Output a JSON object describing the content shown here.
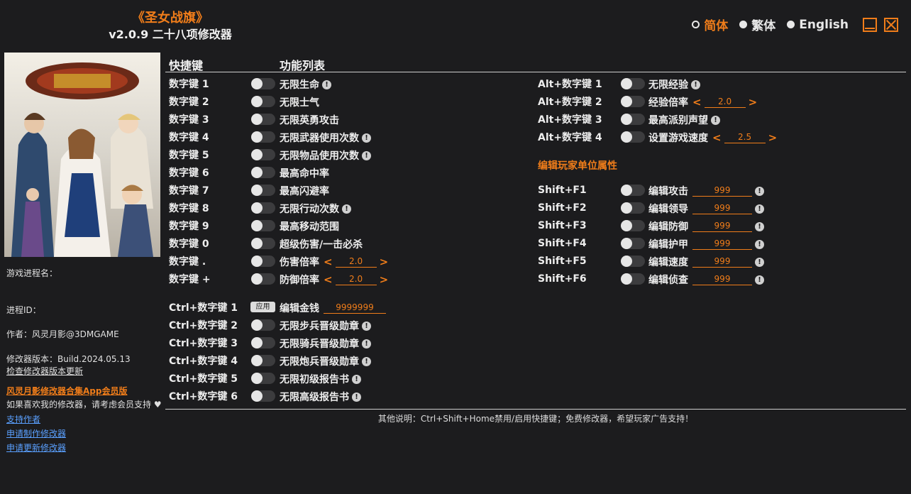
{
  "app": {
    "game_title": "《圣女战旗》",
    "version_line": "v2.0.9 二十八项修改器"
  },
  "languages": [
    {
      "label": "简体",
      "active": true
    },
    {
      "label": "繁体",
      "active": false
    },
    {
      "label": "English",
      "active": false
    }
  ],
  "sidebar": {
    "process_name": "游戏进程名：",
    "process_id": "进程ID：",
    "author": "作者：风灵月影@3DMGAME",
    "trainer_version": "修改器版本：Build.2024.05.13",
    "check_update": "检查修改器版本更新",
    "vip_link": "风灵月影修改器合集App会员版",
    "support_text": "如果喜欢我的修改器，请考虑会员支持",
    "links": [
      "支持作者",
      "申请制作修改器",
      "申请更新修改器"
    ]
  },
  "headers": {
    "hotkey": "快捷键",
    "functions": "功能列表"
  },
  "left_rows": [
    {
      "key": "数字键 1",
      "name": "无限生命",
      "info": true
    },
    {
      "key": "数字键 2",
      "name": "无限士气",
      "info": false
    },
    {
      "key": "数字键 3",
      "name": "无限英勇攻击",
      "info": false
    },
    {
      "key": "数字键 4",
      "name": "无限武器使用次数",
      "info": true
    },
    {
      "key": "数字键 5",
      "name": "无限物品使用次数",
      "info": true
    },
    {
      "key": "数字键 6",
      "name": "最高命中率",
      "info": false
    },
    {
      "key": "数字键 7",
      "name": "最高闪避率",
      "info": false
    },
    {
      "key": "数字键 8",
      "name": "无限行动次数",
      "info": true
    },
    {
      "key": "数字键 9",
      "name": "最高移动范围",
      "info": false
    },
    {
      "key": "数字键 0",
      "name": "超级伤害/一击必杀",
      "info": false
    },
    {
      "key": "数字键 .",
      "name": "伤害倍率",
      "stepper": "2.0"
    },
    {
      "key": "数字键 +",
      "name": "防御倍率",
      "stepper": "2.0"
    }
  ],
  "ctrl_rows": [
    {
      "key": "Ctrl+数字键 1",
      "name": "编辑金钱",
      "apply": "应用",
      "edit": "9999999"
    },
    {
      "key": "Ctrl+数字键 2",
      "name": "无限步兵晋级勋章",
      "info": true
    },
    {
      "key": "Ctrl+数字键 3",
      "name": "无限骑兵晋级勋章",
      "info": true
    },
    {
      "key": "Ctrl+数字键 4",
      "name": "无限炮兵晋级勋章",
      "info": true
    },
    {
      "key": "Ctrl+数字键 5",
      "name": "无限初级报告书",
      "info": true
    },
    {
      "key": "Ctrl+数字键 6",
      "name": "无限高级报告书",
      "info": true
    }
  ],
  "alt_rows": [
    {
      "key": "Alt+数字键 1",
      "name": "无限经验",
      "info": true
    },
    {
      "key": "Alt+数字键 2",
      "name": "经验倍率",
      "stepper": "2.0"
    },
    {
      "key": "Alt+数字键 3",
      "name": "最高派别声望",
      "info": true
    },
    {
      "key": "Alt+数字键 4",
      "name": "设置游戏速度",
      "stepper": "2.5"
    }
  ],
  "unit_section_title": "编辑玩家单位属性",
  "shift_rows": [
    {
      "key": "Shift+F1",
      "name": "编辑攻击",
      "edit": "999"
    },
    {
      "key": "Shift+F2",
      "name": "编辑领导",
      "edit": "999"
    },
    {
      "key": "Shift+F3",
      "name": "编辑防御",
      "edit": "999"
    },
    {
      "key": "Shift+F4",
      "name": "编辑护甲",
      "edit": "999"
    },
    {
      "key": "Shift+F5",
      "name": "编辑速度",
      "edit": "999"
    },
    {
      "key": "Shift+F6",
      "name": "编辑侦查",
      "edit": "999"
    }
  ],
  "footer": "其他说明：Ctrl+Shift+Home禁用/启用快捷键；免费修改器，希望玩家广告支持！",
  "colors": {
    "accent": "#f07d1a",
    "background": "#1c1c1e",
    "link": "#5aa0ff"
  }
}
